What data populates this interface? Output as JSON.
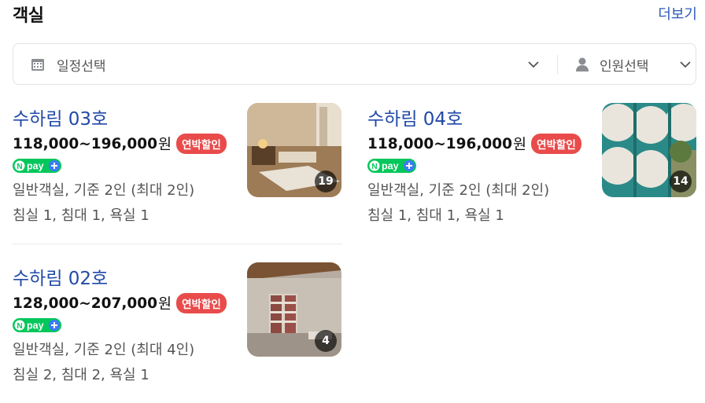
{
  "header": {
    "title": "객실",
    "more_label": "더보기"
  },
  "filter": {
    "date_label": "일정선택",
    "people_label": "인원선택"
  },
  "rooms": [
    {
      "name": "수하림 03호",
      "price": "118,000~196,000",
      "currency": "원",
      "badge": "연박할인",
      "npay": "pay",
      "desc": "일반객실, 기준 2인 (최대 2인)",
      "beds": "침실 1, 침대 1, 욕실 1",
      "photo_count": "19"
    },
    {
      "name": "수하림 04호",
      "price": "118,000~196,000",
      "currency": "원",
      "badge": "연박할인",
      "npay": "pay",
      "desc": "일반객실, 기준 2인 (최대 2인)",
      "beds": "침실 1, 침대 1, 욕실 1",
      "photo_count": "14"
    },
    {
      "name": "수하림 02호",
      "price": "128,000~207,000",
      "currency": "원",
      "badge": "연박할인",
      "npay": "pay",
      "desc": "일반객실, 기준 2인 (최대 4인)",
      "beds": "침실 2, 침대 2, 욕실 1",
      "photo_count": "4"
    }
  ],
  "colors": {
    "link": "#2149a8",
    "badge": "#e94b4b",
    "npay_green": "#03c75a",
    "npay_blue": "#3d7bf7"
  },
  "icons": [
    "calendar-icon",
    "chevron-down-icon",
    "person-icon"
  ]
}
